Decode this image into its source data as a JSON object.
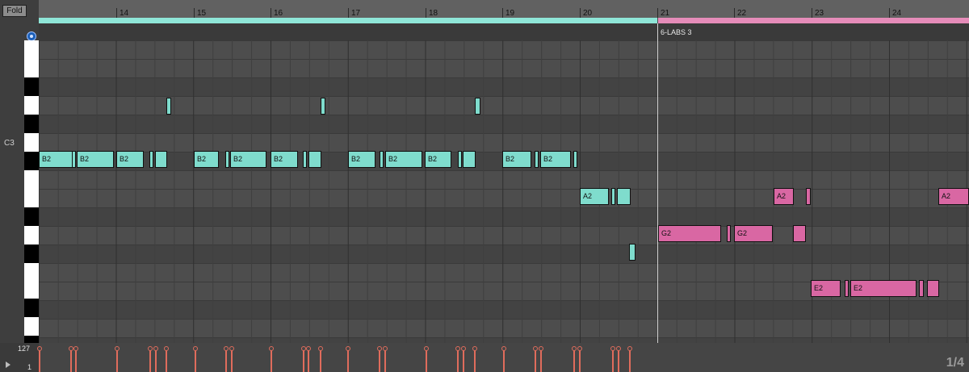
{
  "toolbar": {
    "fold_label": "Fold"
  },
  "keyboard": {
    "c3_label": "C3"
  },
  "ruler": {
    "bars": [
      "14",
      "15",
      "16",
      "17",
      "18",
      "19",
      "20",
      "21",
      "22",
      "23",
      "24"
    ]
  },
  "clip": {
    "name": "6-LABS 3"
  },
  "notes_labels": {
    "b2": "B2",
    "a2": "A2",
    "g2": "G2",
    "e2": "E2"
  },
  "velocity": {
    "max_label": "127",
    "min_label": "1"
  },
  "grid": {
    "fraction": "1/4"
  },
  "colors": {
    "teal": "#7fdccd",
    "pink": "#d967a3",
    "velocity": "#e06c5c"
  }
}
